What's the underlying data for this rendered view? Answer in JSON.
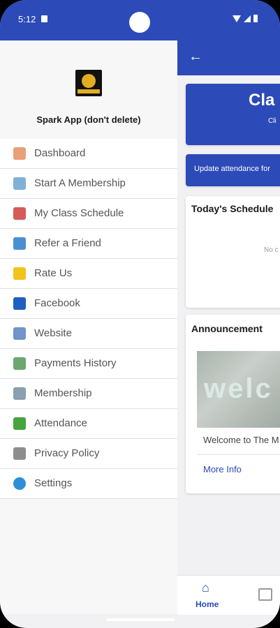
{
  "status_bar": {
    "time": "5:12"
  },
  "app": {
    "class_title": "Cla",
    "class_subtitle": "Cli",
    "update_text": "Update attendance for",
    "schedule_title": "Today's Schedule",
    "schedule_empty": "No c",
    "announcement_title": "Announcement",
    "announcement_image_text": "welc",
    "announcement_text": "Welcome to The M",
    "announcement_link": "More Info",
    "bottom_nav": {
      "home_label": "Home"
    }
  },
  "drawer": {
    "app_name": "Spark App (don't delete)",
    "items": [
      {
        "label": "Dashboard",
        "icon": "house-icon",
        "color": "#e9a07a"
      },
      {
        "label": "Start A Membership",
        "icon": "card-icon",
        "color": "#7fb0d8"
      },
      {
        "label": "My Class Schedule",
        "icon": "calendar-icon",
        "color": "#d65a5a"
      },
      {
        "label": "Refer a Friend",
        "icon": "person-icon",
        "color": "#4a8fd4"
      },
      {
        "label": "Rate Us",
        "icon": "star-icon",
        "color": "#f2c21d"
      },
      {
        "label": "Facebook",
        "icon": "facebook-icon",
        "color": "#1f5fbf"
      },
      {
        "label": "Website",
        "icon": "globe-icon",
        "color": "#6f95c9"
      },
      {
        "label": "Payments History",
        "icon": "wallet-icon",
        "color": "#6aa86f"
      },
      {
        "label": "Membership",
        "icon": "clipboard-icon",
        "color": "#8a9fb0"
      },
      {
        "label": "Attendance",
        "icon": "checkbox-icon",
        "color": "#47a43f"
      },
      {
        "label": "Privacy Policy",
        "icon": "shield-icon",
        "color": "#8e8e8e"
      },
      {
        "label": "Settings",
        "icon": "gear-icon",
        "color": "#2e8fd6"
      }
    ]
  }
}
